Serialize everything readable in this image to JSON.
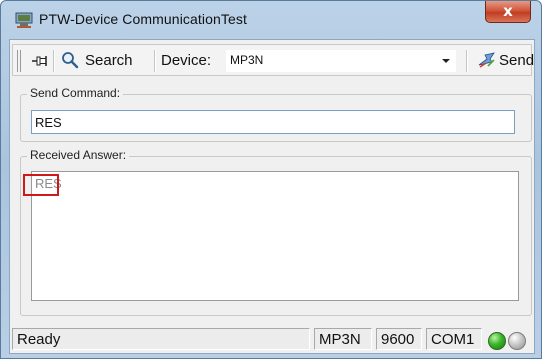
{
  "window": {
    "title": "PTW-Device CommunicationTest",
    "close_label": "x"
  },
  "toolbar": {
    "search_label": "Search",
    "device_label": "Device:",
    "device_value": "MP3N",
    "send_label": "Send"
  },
  "send_command": {
    "label": "Send Command:",
    "value": "RES"
  },
  "received_answer": {
    "label": "Received Answer:",
    "text": "RES"
  },
  "statusbar": {
    "status": "Ready",
    "device": "MP3N",
    "baud": "9600",
    "port": "COM1",
    "led_left": "green",
    "led_right": "gray"
  },
  "colors": {
    "highlight": "#d01818",
    "led_on": "#3cb52a",
    "led_off": "#c9c9c9"
  },
  "icons": [
    "app-icon",
    "pin-icon",
    "search-icon",
    "send-icon"
  ]
}
